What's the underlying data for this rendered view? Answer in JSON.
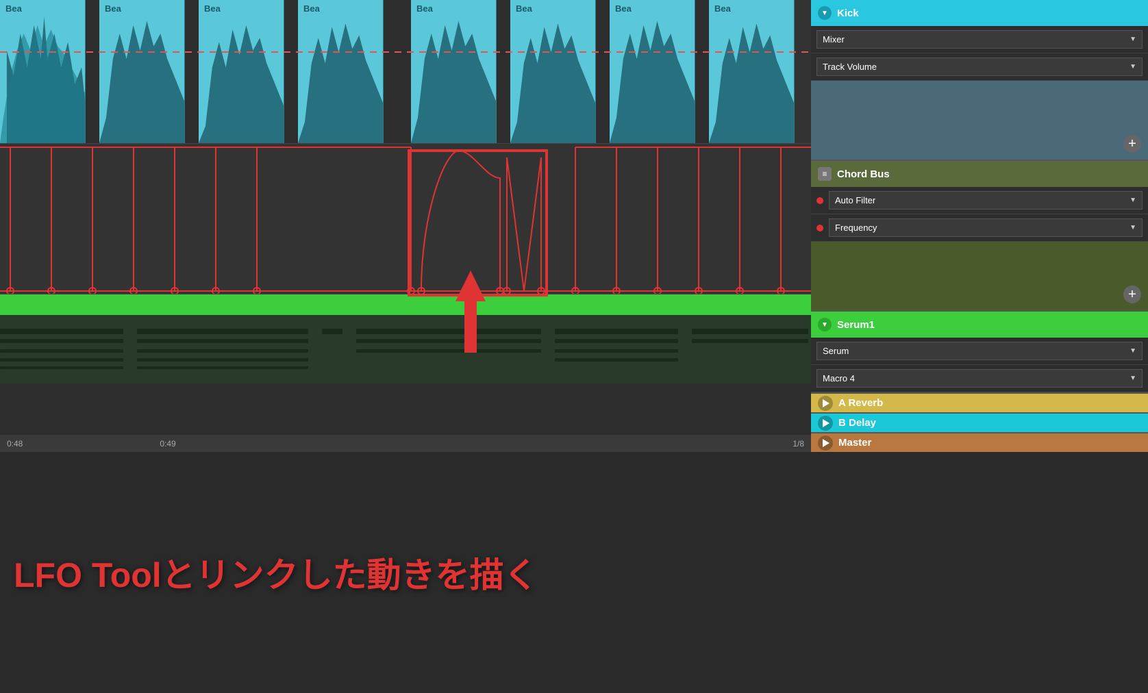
{
  "tracks": {
    "beat_clips": [
      {
        "label": "Bea",
        "id": 1
      },
      {
        "label": "Bea",
        "id": 2
      },
      {
        "label": "Bea",
        "id": 3
      },
      {
        "label": "Bea",
        "id": 4
      },
      {
        "label": "Bea",
        "id": 5
      },
      {
        "label": "Bea",
        "id": 6
      },
      {
        "label": "Bea",
        "id": 7
      },
      {
        "label": "Bea",
        "id": 8
      }
    ],
    "kick": {
      "name": "Kick",
      "mixer": "Mixer",
      "track_volume": "Track Volume"
    },
    "chord_bus": {
      "name": "Chord Bus",
      "auto_filter": "Auto Filter",
      "frequency": "Frequency"
    },
    "serum1": {
      "name": "Serum1",
      "serum": "Serum",
      "macro4": "Macro 4"
    },
    "a_reverb": {
      "name": "A Reverb"
    },
    "b_delay": {
      "name": "B Delay"
    },
    "master": {
      "name": "Master"
    }
  },
  "timestamps": {
    "left": "0:48",
    "right": "1/8",
    "mid": "0:49"
  },
  "annotation": {
    "text": "LFO Toolとリンクした動きを描く"
  },
  "icons": {
    "dropdown_arrow": "▼",
    "plus": "+",
    "play": "▶",
    "equals": "≡",
    "down_arrow_circle": "⊙"
  }
}
